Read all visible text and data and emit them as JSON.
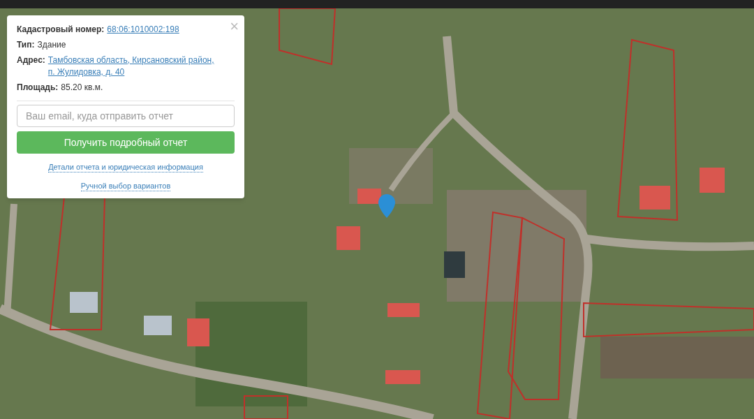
{
  "popup": {
    "fields": [
      {
        "label": "Кадастровый номер:",
        "value": "68:06:1010002:198",
        "kind": "link"
      },
      {
        "label": "Тип:",
        "value": "Здание",
        "kind": "text"
      },
      {
        "label": "Адрес:",
        "value": "Тамбовская область, Кирсановский район, п. Жулидовка, д. 40",
        "kind": "link"
      },
      {
        "label": "Площадь:",
        "value": "85.20 кв.м.",
        "kind": "text"
      }
    ],
    "close": "×",
    "email": {
      "placeholder": "Ваш email, куда отправить отчет"
    },
    "submit": "Получить подробный отчет",
    "links": [
      "Детали отчета и юридическая информация",
      "Ручной выбор вариантов"
    ]
  }
}
